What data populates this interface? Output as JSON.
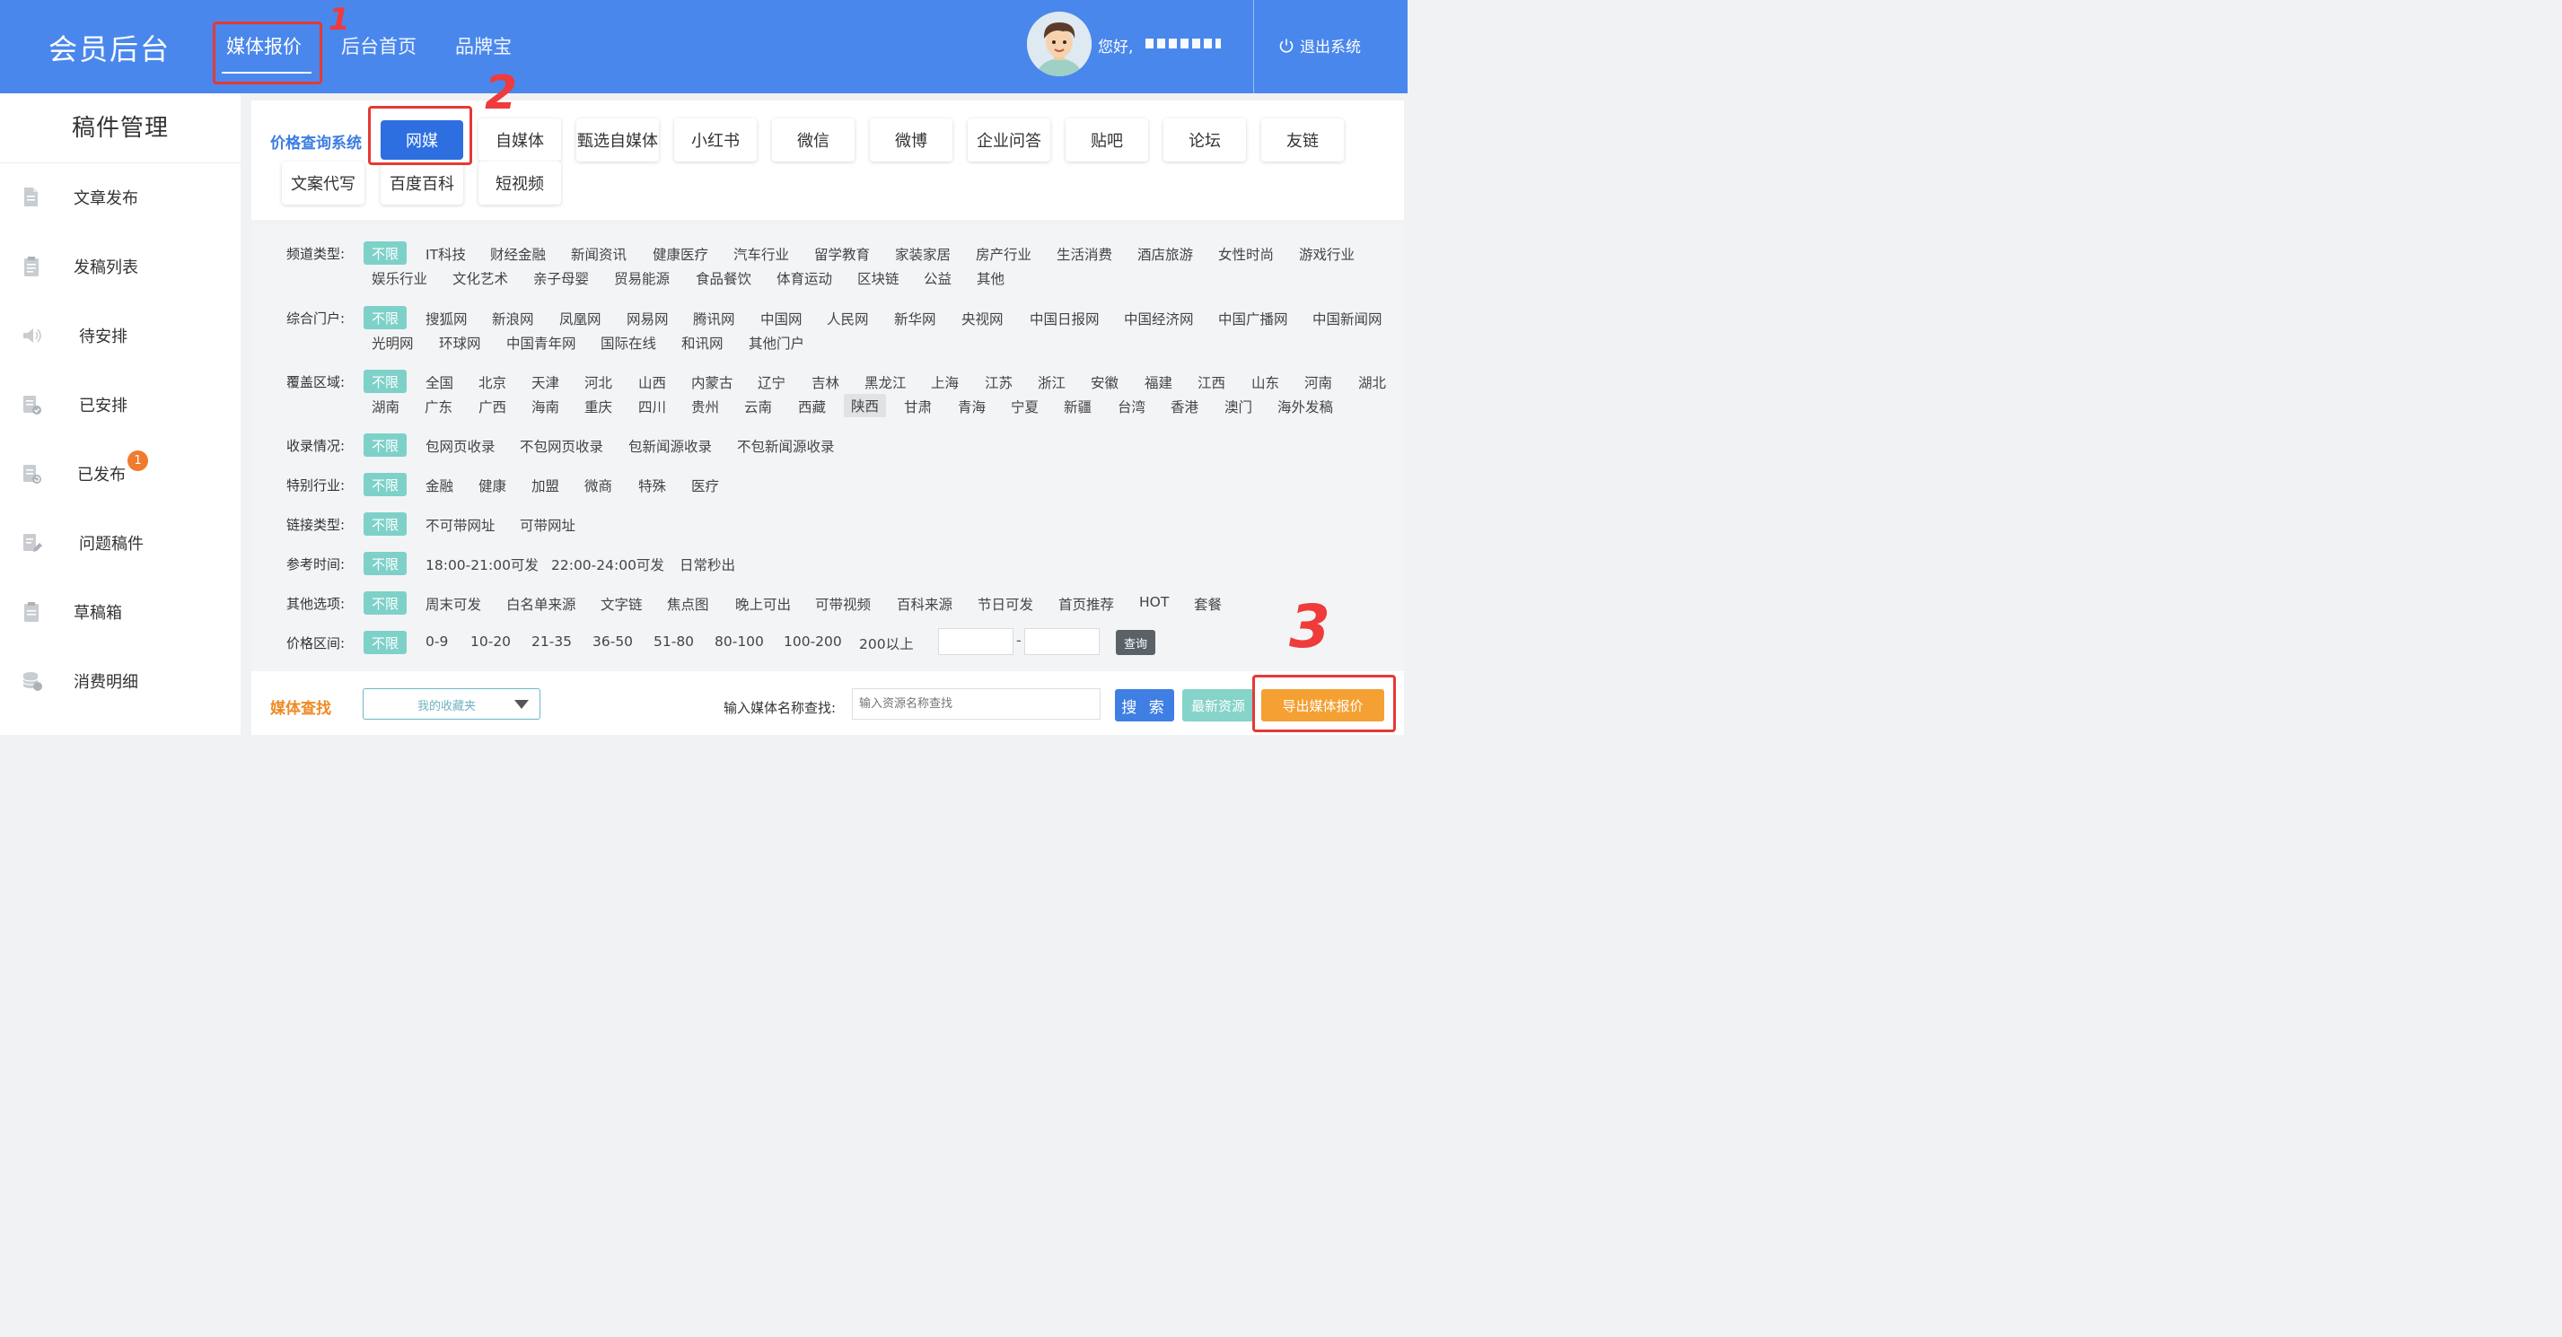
{
  "header": {
    "brand": "会员后台",
    "nav": [
      "媒体报价",
      "后台首页",
      "品牌宝"
    ],
    "greeting": "您好,",
    "logout": "退出系统",
    "accent": "#4a87ec"
  },
  "annotations": [
    "1",
    "2",
    "3"
  ],
  "sidebar": {
    "title": "稿件管理",
    "items": [
      {
        "label": "文章发布",
        "icon": "document-icon"
      },
      {
        "label": "发稿列表",
        "icon": "clipboard-list-icon"
      },
      {
        "label": "待安排",
        "icon": "speaker-icon"
      },
      {
        "label": "已安排",
        "icon": "doc-check-icon"
      },
      {
        "label": "已发布",
        "icon": "doc-refresh-icon",
        "badge": "1"
      },
      {
        "label": "问题稿件",
        "icon": "doc-edit-icon"
      },
      {
        "label": "草稿箱",
        "icon": "drafts-icon"
      },
      {
        "label": "消费明细",
        "icon": "coins-icon"
      }
    ]
  },
  "price_system": {
    "label": "价格查询系统",
    "categories": [
      "网媒",
      "自媒体",
      "甄选自媒体",
      "小红书",
      "微信",
      "微博",
      "企业问答",
      "贴吧",
      "论坛",
      "友链",
      "文案代写",
      "百度百科",
      "短视频"
    ],
    "active": "网媒"
  },
  "filters": {
    "all_label": "不限",
    "rows": [
      {
        "label": "频道类型:",
        "options": [
          [
            "IT科技",
            "财经金融",
            "新闻资讯",
            "健康医疗",
            "汽车行业",
            "留学教育",
            "家装家居",
            "房产行业",
            "生活消费",
            "酒店旅游",
            "女性时尚",
            "游戏行业"
          ],
          [
            "娱乐行业",
            "文化艺术",
            "亲子母婴",
            "贸易能源",
            "食品餐饮",
            "体育运动",
            "区块链",
            "公益",
            "其他"
          ]
        ]
      },
      {
        "label": "综合门户:",
        "options": [
          [
            "搜狐网",
            "新浪网",
            "凤凰网",
            "网易网",
            "腾讯网",
            "中国网",
            "人民网",
            "新华网",
            "央视网",
            "中国日报网",
            "中国经济网",
            "中国广播网",
            "中国新闻网"
          ],
          [
            "光明网",
            "环球网",
            "中国青年网",
            "国际在线",
            "和讯网",
            "其他门户"
          ]
        ]
      },
      {
        "label": "覆盖区域:",
        "options": [
          [
            "全国",
            "北京",
            "天津",
            "河北",
            "山西",
            "内蒙古",
            "辽宁",
            "吉林",
            "黑龙江",
            "上海",
            "江苏",
            "浙江",
            "安徽",
            "福建",
            "江西",
            "山东",
            "河南",
            "湖北"
          ],
          [
            "湖南",
            "广东",
            "广西",
            "海南",
            "重庆",
            "四川",
            "贵州",
            "云南",
            "西藏",
            "陕西",
            "甘肃",
            "青海",
            "宁夏",
            "新疆",
            "台湾",
            "香港",
            "澳门",
            "海外发稿"
          ]
        ],
        "selected": "陕西"
      },
      {
        "label": "收录情况:",
        "options": [
          [
            "包网页收录",
            "不包网页收录",
            "包新闻源收录",
            "不包新闻源收录"
          ]
        ]
      },
      {
        "label": "特别行业:",
        "options": [
          [
            "金融",
            "健康",
            "加盟",
            "微商",
            "特殊",
            "医疗"
          ]
        ]
      },
      {
        "label": "链接类型:",
        "options": [
          [
            "不可带网址",
            "可带网址"
          ]
        ]
      },
      {
        "label": "参考时间:",
        "options": [
          [
            "18:00-21:00可发",
            "22:00-24:00可发",
            "日常秒出"
          ]
        ]
      },
      {
        "label": "其他选项:",
        "options": [
          [
            "周末可发",
            "白名单来源",
            "文字链",
            "焦点图",
            "晚上可出",
            "可带视频",
            "百科来源",
            "节日可发",
            "首页推荐",
            "HOT",
            "套餐"
          ]
        ]
      },
      {
        "label": "价格区间:",
        "options": [
          [
            "0-9",
            "10-20",
            "21-35",
            "36-50",
            "51-80",
            "80-100",
            "100-200",
            "200以上"
          ]
        ]
      }
    ],
    "price_dash": "-",
    "query_label": "查询"
  },
  "bottom": {
    "find_label": "媒体查找",
    "favorites": "我的收藏夹",
    "search_label": "输入媒体名称查找:",
    "search_placeholder": "输入资源名称查找",
    "search_btn": "搜 索",
    "new_btn": "最新资源",
    "export_btn": "导出媒体报价"
  }
}
